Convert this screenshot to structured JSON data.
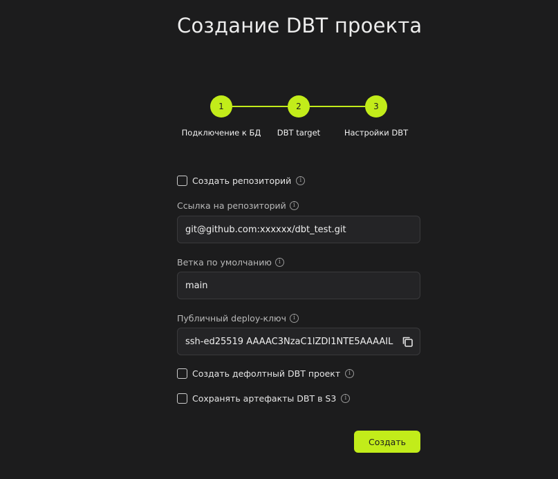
{
  "page": {
    "title": "Создание DBT проекта"
  },
  "stepper": {
    "steps": [
      {
        "number": "1",
        "label": "Подключение к БД"
      },
      {
        "number": "2",
        "label": "DBT target"
      },
      {
        "number": "3",
        "label": "Настройки DBT"
      }
    ],
    "active_color": "#c2ec1a"
  },
  "form": {
    "create_repo": {
      "label": "Создать репозиторий",
      "checked": false
    },
    "repo_url": {
      "label": "Ссылка на репозиторий",
      "value": "git@github.com:xxxxxx/dbt_test.git"
    },
    "default_branch": {
      "label": "Ветка по умолчанию",
      "value": "main"
    },
    "deploy_key": {
      "label": "Публичный deploy-ключ",
      "value": "ssh-ed25519 AAAAC3NzaC1lZDI1NTE5AAAAIL"
    },
    "create_default_project": {
      "label": "Создать дефолтный DBT проект",
      "checked": false
    },
    "save_artifacts": {
      "label": "Сохранять артефакты DBT в S3",
      "checked": false
    },
    "info_icon": "info-icon",
    "copy_icon": "copy-icon"
  },
  "actions": {
    "submit_label": "Создать"
  }
}
